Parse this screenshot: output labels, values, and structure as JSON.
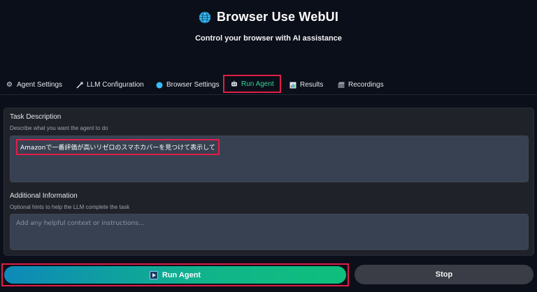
{
  "header": {
    "title": "Browser Use WebUI",
    "subtitle": "Control your browser with AI assistance"
  },
  "tabs": [
    {
      "label": "Agent Settings",
      "icon": "gear-icon"
    },
    {
      "label": "LLM Configuration",
      "icon": "wrench-icon"
    },
    {
      "label": "Browser Settings",
      "icon": "globe-icon"
    },
    {
      "label": "Run Agent",
      "icon": "robot-icon",
      "active": true
    },
    {
      "label": "Results",
      "icon": "chart-icon"
    },
    {
      "label": "Recordings",
      "icon": "film-icon"
    }
  ],
  "task": {
    "label": "Task Description",
    "hint": "Describe what you want the agent to do",
    "value": "Amazonで一番評価が高いリゼロのスマホカバーを見つけて表示して"
  },
  "additional": {
    "label": "Additional Information",
    "hint": "Optional hints to help the LLM complete the task",
    "placeholder": "Add any helpful context or instructions..."
  },
  "buttons": {
    "run": "Run Agent",
    "stop": "Stop"
  },
  "colors": {
    "accent": "#34d399",
    "highlight_border": "#e11d48",
    "background": "#0b0f19"
  }
}
